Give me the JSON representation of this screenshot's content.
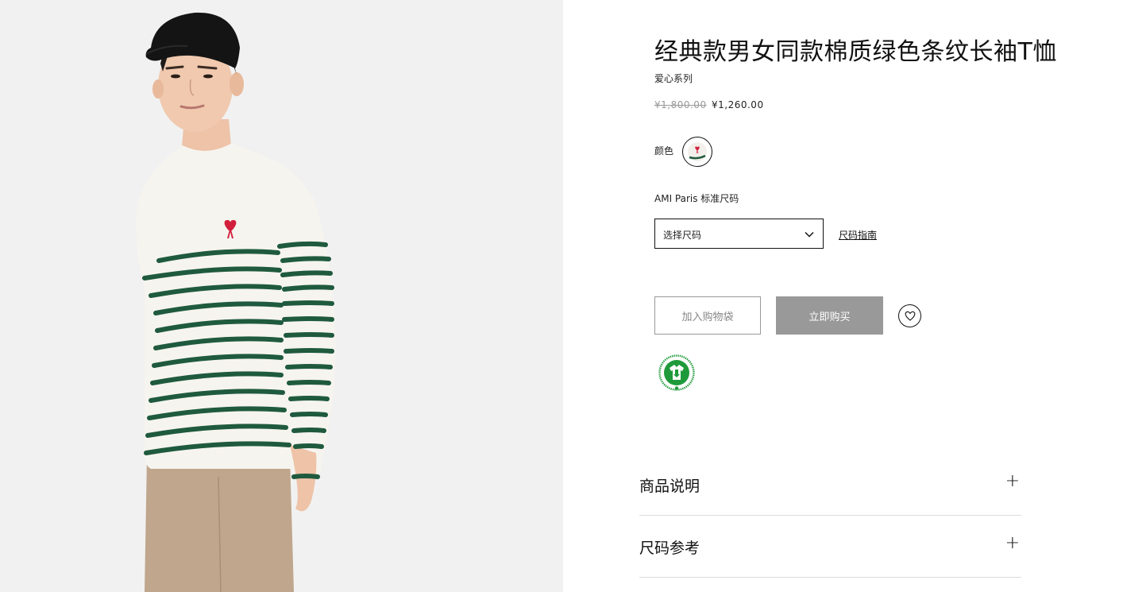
{
  "product": {
    "title": "经典款男女同款棉质绿色条纹长袖T恤",
    "collection": "爱心系列",
    "price_original": "¥1,800.00",
    "price_sale": "¥1,260.00"
  },
  "color": {
    "label": "颜色",
    "swatch_icon": "heart-tshirt-swatch"
  },
  "size": {
    "label": "AMI Paris 标准尺码",
    "select_placeholder": "选择尺码",
    "guide_link": "尺码指南"
  },
  "actions": {
    "add_to_bag": "加入购物袋",
    "buy_now": "立即购买",
    "wishlist_icon": "heart-icon"
  },
  "certification": {
    "icon": "gots-organic-logo",
    "ring_text": "GLOBAL ORGANIC TEXTILE STANDARD"
  },
  "accordions": [
    {
      "title": "商品说明",
      "icon": "plus-icon"
    },
    {
      "title": "尺码参考",
      "icon": "plus-icon"
    }
  ],
  "colors": {
    "stripe_green": "#1f5a3e",
    "logo_red": "#d21f3c",
    "buy_button": "#999999"
  }
}
